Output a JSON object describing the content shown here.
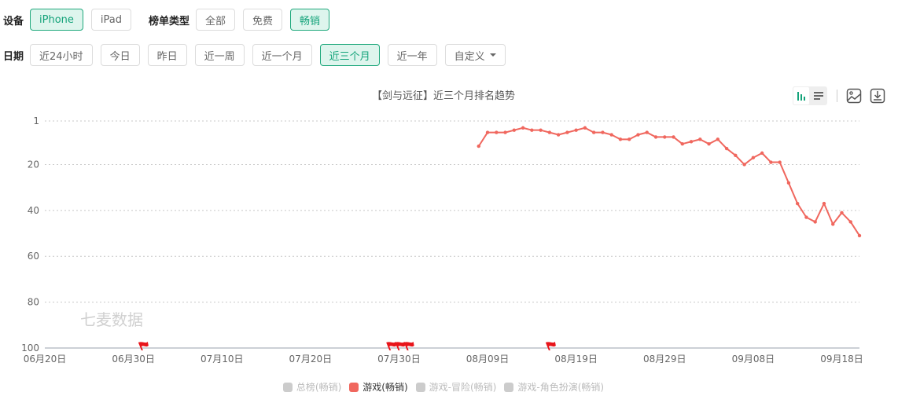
{
  "filters": {
    "device_label": "设备",
    "devices": [
      {
        "label": "iPhone",
        "active": true
      },
      {
        "label": "iPad",
        "active": false
      }
    ],
    "list_type_label": "榜单类型",
    "list_types": [
      {
        "label": "全部",
        "active": false
      },
      {
        "label": "免费",
        "active": false
      },
      {
        "label": "畅销",
        "active": true
      }
    ],
    "date_label": "日期",
    "dates": [
      {
        "label": "近24小时",
        "active": false
      },
      {
        "label": "今日",
        "active": false
      },
      {
        "label": "昨日",
        "active": false
      },
      {
        "label": "近一周",
        "active": false
      },
      {
        "label": "近一个月",
        "active": false
      },
      {
        "label": "近三个月",
        "active": true
      },
      {
        "label": "近一年",
        "active": false
      }
    ],
    "custom_label": "自定义"
  },
  "toolbar": {
    "icons": [
      "bar-chart-icon",
      "list-icon",
      "image-icon",
      "download-icon"
    ]
  },
  "colors": {
    "accent": "#14a37a",
    "series": "#f0675e",
    "flag": "#e8141a",
    "inactive_legend": "#cccccc"
  },
  "chart_data": {
    "type": "line",
    "title": "【剑与远征】近三个月排名趋势",
    "watermark": "七麦数据",
    "xlabel": "",
    "ylabel": "",
    "y_inverted": true,
    "ylim": [
      1,
      100
    ],
    "y_ticks": [
      "1",
      "20",
      "40",
      "60",
      "80",
      "100"
    ],
    "x_range": [
      "06-20",
      "09-20"
    ],
    "x_ticks": [
      "06月20日",
      "06月30日",
      "07月10日",
      "07月20日",
      "07月30日",
      "08月09日",
      "08月19日",
      "08月29日",
      "09月08日",
      "09月18日"
    ],
    "grid": true,
    "legend_position": "bottom",
    "legend": [
      {
        "name": "总榜(畅销)",
        "active": false
      },
      {
        "name": "游戏(畅销)",
        "active": true
      },
      {
        "name": "游戏-冒险(畅销)",
        "active": false
      },
      {
        "name": "游戏-角色扮演(畅销)",
        "active": false
      }
    ],
    "series": [
      {
        "name": "游戏(畅销)",
        "start_date": "08-08",
        "values": [
          12,
          6,
          6,
          6,
          5,
          4,
          5,
          5,
          6,
          7,
          6,
          5,
          4,
          6,
          6,
          7,
          9,
          9,
          7,
          6,
          8,
          8,
          8,
          11,
          10,
          9,
          11,
          9,
          13,
          16,
          20,
          17,
          15,
          19,
          19,
          28,
          37,
          43,
          45,
          37,
          46,
          41,
          45,
          51
        ]
      }
    ],
    "event_flags": [
      "07-01",
      "07-29",
      "07-30",
      "07-31",
      "08-16"
    ]
  }
}
